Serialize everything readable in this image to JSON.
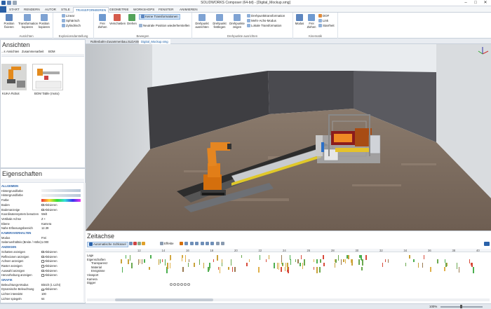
{
  "window": {
    "title": "SOLIDWORKS Composer (64-bit) - [Digital_Mockup.smg]",
    "minimize_icon": "minimize-icon",
    "maximize_icon": "maximize-icon",
    "close_icon": "close-icon"
  },
  "tabs": [
    "START",
    "RENDERN",
    "AUTOR",
    "STILE",
    "TRANSFORMIEREN",
    "GEOMETRIE",
    "WORKSHOPS",
    "FENSTER",
    "ANIMIEREN"
  ],
  "active_tab": "TRANSFORMIEREN",
  "ribbon": {
    "groups": [
      {
        "label": "Ausrichten",
        "buttons": [
          "Position fixieren",
          "Transformation kopieren",
          "Position kopieren"
        ]
      },
      {
        "label": "Explosionsdarstellung",
        "rows": [
          "Linear",
          "Sphärisch",
          "Zylindrisch"
        ]
      },
      {
        "label": "Bewegen",
        "buttons": [
          "Frei Ziehen",
          "Verschieben",
          "Drehen"
        ],
        "rows": [
          "Keine Transformationen",
          "Neutrale Position wiederherstellen"
        ]
      },
      {
        "label": "Drehpunkte ausrichten",
        "buttons": [
          "Drehpunkt ausrichten",
          "Drehpunkt festlegen",
          "Drehpunkte zeigen"
        ],
        "rows": [
          "Drehpunkttransformation",
          "Mehr-Achs-Modus",
          "Lokale Transformation"
        ]
      },
      {
        "label": "Kinematik",
        "buttons": [
          "Modus",
          "Frei Ziehen"
        ],
        "rows": [
          "DOF",
          "Link",
          "Starrheit"
        ]
      }
    ]
  },
  "doc_tabs": [
    "Rollenbahn-Zusammenbau.SLDASM",
    "Digital_Mockup.smg"
  ],
  "active_doc_tab": "Digital_Mockup.smg",
  "views_panel": {
    "title": "Ansichten",
    "subtabs": [
      "...s",
      "Ansichten",
      "Zusammenarbeit",
      "BOM"
    ],
    "thumbnails": [
      {
        "label": "KUKA Robot"
      },
      {
        "label": "BOM Table (moto)"
      }
    ]
  },
  "properties_panel": {
    "title": "Eigenschaften",
    "sections": [
      "Allgemein",
      "Kamera",
      "Viewport",
      "Zeitachse",
      "Grafik"
    ],
    "rows": [
      {
        "label": "ALLGEMEIN",
        "value": "",
        "section": true
      },
      {
        "label": "Hintergrundfarbe",
        "value": "gradient"
      },
      {
        "label": "Hintergrundfarbe",
        "value": "gradient2"
      },
      {
        "label": "Farbe",
        "value": "gradient3"
      },
      {
        "label": "Boden",
        "value": "Aktivieren",
        "cb": true
      },
      {
        "label": "Bodenanzeige",
        "value": "Aktivieren",
        "cb": true
      },
      {
        "label": "Koordinatensystem benutzen",
        "value": "Welt"
      },
      {
        "label": "Vertikale Achse",
        "value": "Z +"
      },
      {
        "label": "Ebene",
        "value": "Kamera"
      },
      {
        "label": "Nahe Erfassungsbereich",
        "value": "12.39"
      },
      {
        "label": "KAMERAVERHALTEN",
        "value": "",
        "section": true
      },
      {
        "label": "Modus",
        "value": "Frei"
      },
      {
        "label": "Seitenverhältnis (Breite / Höhe)",
        "value": "1.000"
      },
      {
        "label": "ANZEIGEN",
        "value": "",
        "section": true
      },
      {
        "label": "Schatten anzeigen",
        "value": "Aktivieren",
        "cb": true
      },
      {
        "label": "Reflexionen anzeigen",
        "value": "Aktivieren",
        "cb": true
      },
      {
        "label": "Achsen anzeigen",
        "value": "Aktivieren",
        "cb": true
      },
      {
        "label": "Raster anzeigen",
        "value": "Aktivieren",
        "cb": true
      },
      {
        "label": "Auswahl anzeigen",
        "value": "Aktivieren",
        "cb": true
      },
      {
        "label": "Hervorhebung anzeigen",
        "value": "Aktivieren",
        "cb": true
      },
      {
        "label": "GRAFIK",
        "value": "",
        "section": true
      },
      {
        "label": "Beleuchtungs-Modus",
        "value": "Bleich (1 Licht)"
      },
      {
        "label": "Dynamische Beleuchtung",
        "value": "Aktivieren",
        "cb": true
      },
      {
        "label": "Lichter intensität",
        "value": "100"
      },
      {
        "label": "Lichter spiegeln",
        "value": "64"
      }
    ]
  },
  "timeline": {
    "title": "Zeitachse",
    "auto_key_label": "Automatische Schlüssel",
    "effects_label": "Effekte",
    "ticks": [
      "12",
      "14",
      "16",
      "18",
      "20",
      "22",
      "24",
      "26",
      "28",
      "30",
      "32",
      "34",
      "36",
      "38",
      "40"
    ],
    "tracks": [
      "Lage",
      "Eigenschaften",
      "Transparenz",
      "Material",
      "Ereignisse",
      "Viewport",
      "Kamera",
      "Digger"
    ]
  },
  "statusbar": {
    "zoom": "100%"
  },
  "colors": {
    "accent": "#1a5fa8",
    "robot_orange": "#e0770f",
    "floor": "#7b6a5c"
  }
}
